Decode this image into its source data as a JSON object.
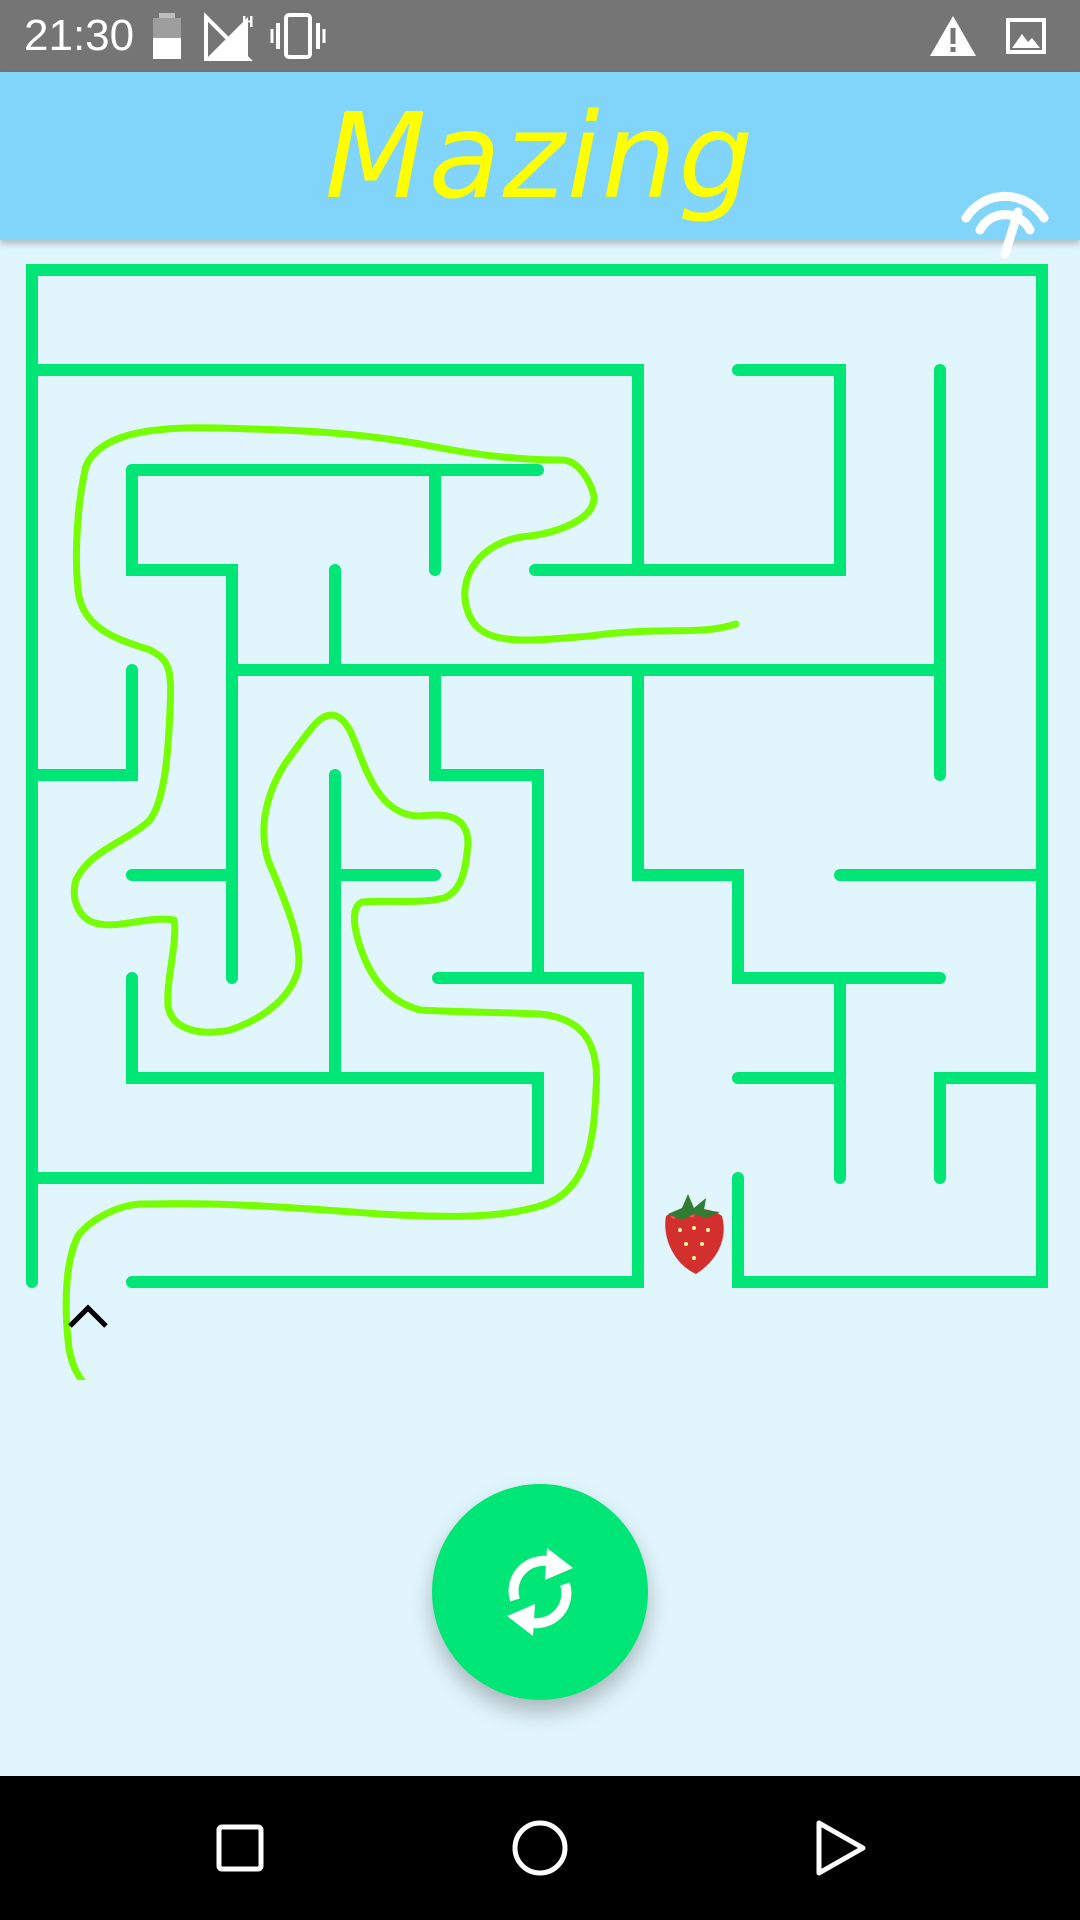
{
  "status_bar": {
    "time": "21:30",
    "icons": [
      "battery-icon",
      "signal-h-icon",
      "vibrate-icon",
      "warning-icon",
      "image-icon"
    ]
  },
  "app_bar": {
    "title": "Mazing",
    "action_icon": "speedometer-icon"
  },
  "game": {
    "wall_color": "#00e676",
    "path_color": "#76ff03",
    "goal_icon": "strawberry-icon",
    "player_icon": "caret-up-icon"
  },
  "fab": {
    "icon": "refresh-icon",
    "color": "#00e676"
  },
  "nav_bar": {
    "buttons": [
      "recents-square-icon",
      "home-circle-icon",
      "back-triangle-icon"
    ]
  },
  "colors": {
    "status_bar": "#757575",
    "app_bar": "#81d4fa",
    "title": "#ffff00",
    "background": "#e1f5fc"
  }
}
